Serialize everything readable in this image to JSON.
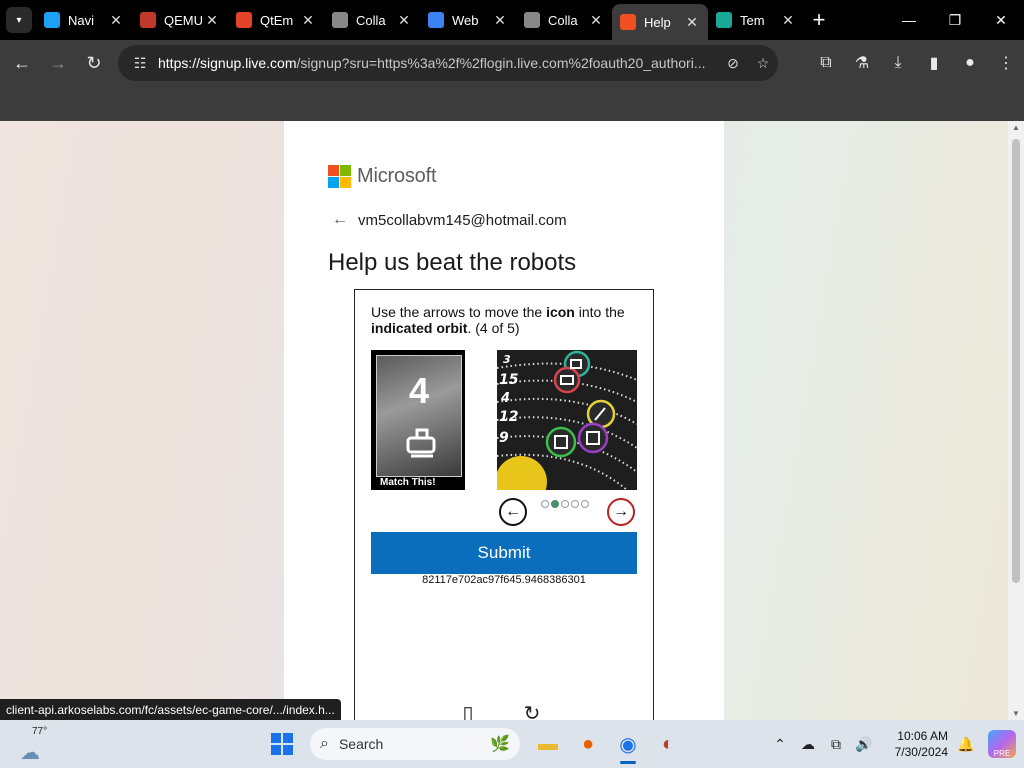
{
  "browser": {
    "tabs": [
      {
        "title": "Navi",
        "favicon_color": "#1da1f2",
        "active": false
      },
      {
        "title": "QEMU",
        "favicon_color": "#c0392b",
        "active": false
      },
      {
        "title": "QtEm",
        "favicon_color": "#e24329",
        "active": false
      },
      {
        "title": "Colla",
        "favicon_color": "#888888",
        "active": false
      },
      {
        "title": "Web",
        "favicon_color": "#3b82f6",
        "active": false
      },
      {
        "title": "Colla",
        "favicon_color": "#888888",
        "active": false
      },
      {
        "title": "Help",
        "favicon_color": "#f25022",
        "active": true
      },
      {
        "title": "Tem",
        "favicon_color": "#1aa897",
        "active": false
      }
    ],
    "url_domain": "https://signup.live.com",
    "url_rest": "/signup?sru=https%3a%2f%2flogin.live.com%2foauth20_authori..."
  },
  "page": {
    "brand": "Microsoft",
    "account_email": "vm5collabvm145@hotmail.com",
    "heading": "Help us beat the robots",
    "challenge": {
      "instruction_prefix": "Use the arrows to move the ",
      "instruction_icon_word": "icon",
      "instruction_middle": " into the ",
      "instruction_orbit_word": "indicated orbit",
      "instruction_suffix": ". (4 of 5)",
      "match_number": "4",
      "match_caption": "Match This!",
      "orbit_numbers": [
        "3",
        "15",
        "4",
        "12",
        "9"
      ],
      "dots_total": 5,
      "dots_active": 2,
      "submit_label": "Submit",
      "session_id": "82117e702ac97f645.9468386301"
    }
  },
  "status_url": "client-api.arkoselabs.com/fc/assets/ec-game-core/.../index.h...",
  "taskbar": {
    "temperature": "77°",
    "search_label": "Search",
    "time": "10:06 AM",
    "date": "7/30/2024",
    "copilot_badge": "PRE"
  }
}
